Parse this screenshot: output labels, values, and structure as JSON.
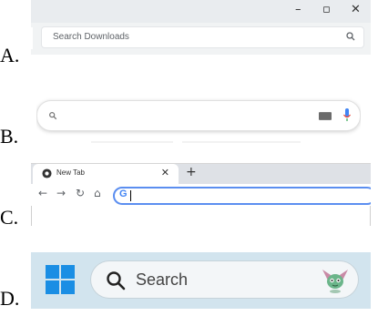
{
  "options": [
    {
      "letter": "A."
    },
    {
      "letter": "B."
    },
    {
      "letter": "C."
    },
    {
      "letter": "D."
    }
  ],
  "panel_a": {
    "window_controls": {
      "minimize": "–",
      "restore": "▫",
      "close": "✕"
    },
    "search_placeholder": "Search Downloads",
    "search_icon": "search-icon"
  },
  "panel_b": {
    "search_icon": "search-icon",
    "keyboard_icon": "keyboard-icon",
    "mic_icon": "microphone-icon"
  },
  "panel_c": {
    "tab_title": "New Tab",
    "tab_close": "✕",
    "new_tab": "+",
    "nav": {
      "back": "←",
      "forward": "→",
      "reload": "↻",
      "home": "⌂"
    },
    "omnibox_mark": "G",
    "accent": "#5b8ef0"
  },
  "panel_d": {
    "search_placeholder": "Search",
    "start_icon": "windows-logo-icon",
    "search_icon": "search-icon",
    "mascot_icon": "mascot-icon",
    "taskbar_color": "#d2e4ee",
    "start_color": "#1a8ee4"
  }
}
